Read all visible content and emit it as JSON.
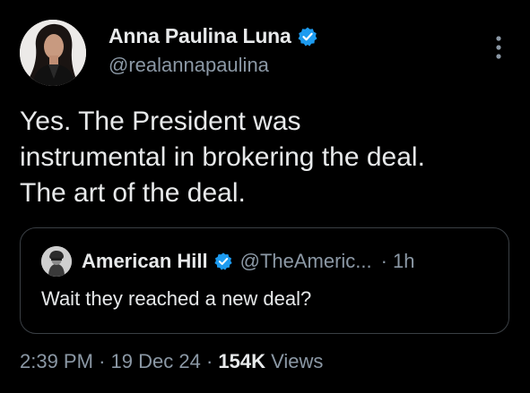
{
  "author": {
    "display_name": "Anna Paulina Luna",
    "handle": "@realannapaulina"
  },
  "tweet": {
    "lines": [
      "Yes. The President was",
      "instrumental in brokering the deal.",
      "The art of the deal."
    ]
  },
  "quoted_tweet": {
    "display_name": "American Hill",
    "handle": "@TheAmeric...",
    "separator": "·",
    "time": "1h",
    "text": "Wait they reached a new deal?"
  },
  "meta": {
    "time": "2:39 PM",
    "separator1": "·",
    "date": "19 Dec 24",
    "separator2": "·",
    "views_count": "154K",
    "views_label": "Views"
  },
  "icons": {
    "verified": "verified-badge-icon",
    "more": "more-vertical-icon"
  },
  "colors": {
    "background": "#000000",
    "primary_text": "#e7e9ea",
    "secondary_text": "#8b98a5",
    "verified_blue": "#1d9bf0",
    "quote_border": "#3a3f44"
  }
}
